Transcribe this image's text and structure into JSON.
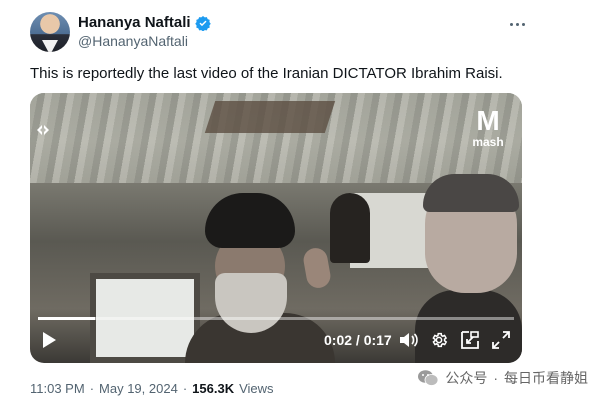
{
  "author": {
    "display_name": "Hananya Naftali",
    "handle": "@HananyaNaftali",
    "verified": true
  },
  "tweet": {
    "text": "This is reportedly the last video of the Iranian DICTATOR Ibrahim Raisi."
  },
  "video": {
    "watermark": "mash",
    "current_time": "0:02",
    "duration": "0:17",
    "time_display": "0:02 / 0:17",
    "progress_fraction": 0.12
  },
  "meta": {
    "time": "11:03 PM",
    "date": "May 19, 2024",
    "views_count": "156.3K",
    "views_label": "Views",
    "separator": "·"
  },
  "source_credit": {
    "platform": "公众号",
    "separator": "·",
    "account": "每日币看静姐"
  },
  "colors": {
    "verified_blue": "#1d9bf0",
    "text_primary": "#0f1419",
    "text_secondary": "#536471"
  }
}
